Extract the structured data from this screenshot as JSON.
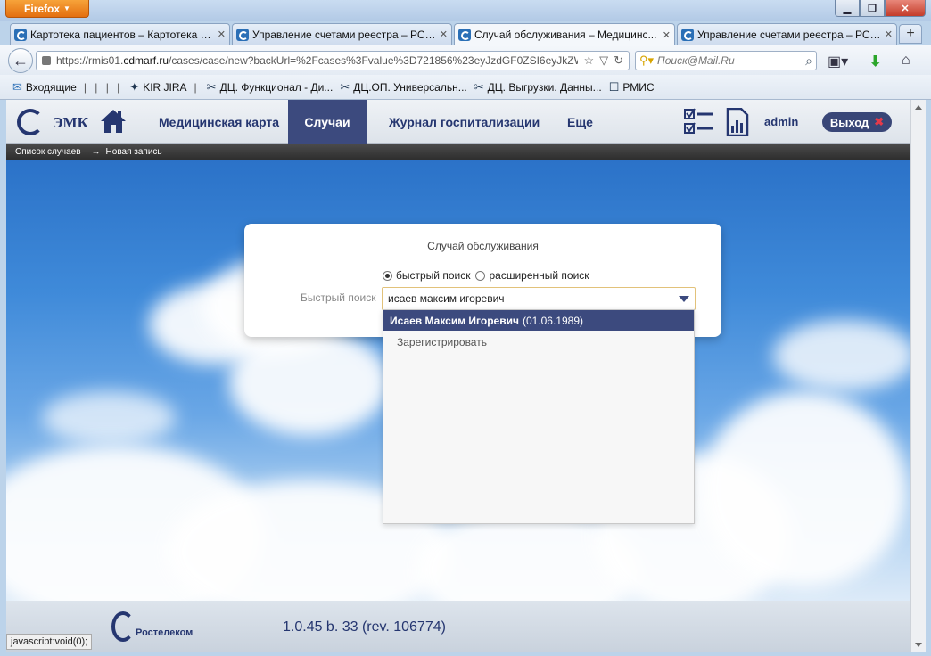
{
  "browser": {
    "menu_label": "Firefox",
    "tabs": [
      {
        "title": "Картотека пациентов – Картотека п..."
      },
      {
        "title": "Управление счетами реестра – РС Е..."
      },
      {
        "title": "Случай обслуживания – Медицинс..."
      },
      {
        "title": "Управление счетами реестра – РС Е..."
      }
    ],
    "new_tab": "+",
    "url_prefix": "https://rmis01.",
    "url_domain": "cdmarf.ru",
    "url_rest": "/cases/case/new?backUrl=%2Fcases%3Fvalue%3D721856%23eyJzdGF0ZSI6eyJkZWZh",
    "search_placeholder": "Поиск@Mail.Ru",
    "bookmarks": [
      "Входящие",
      "KIR JIRA",
      "ДЦ. Функционал - Ди...",
      "ДЦ.ОП. Универсальн...",
      "ДЦ. Выгрузки. Данны...",
      "РМИС"
    ],
    "status_text": "javascript:void(0);"
  },
  "app": {
    "brand": "ЭМК",
    "nav": [
      "Медицинская карта",
      "Случаи",
      "Журнал госпитализации",
      "Еще"
    ],
    "user": "admin",
    "logout": "Выход",
    "breadcrumb_root": "Список случаев",
    "breadcrumb_arrow": "→",
    "breadcrumb_current": "Новая запись"
  },
  "dialog": {
    "title": "Случай обслуживания",
    "radio_quick": "быстрый поиск",
    "radio_extended": "расширенный поиск",
    "quick_label": "Быстрый поиск",
    "query": "исаев максим игоревич"
  },
  "dropdown": {
    "selected_name": "Исаев Максим Игоревич",
    "selected_date": "(01.06.1989)",
    "register": "Зарегистрировать"
  },
  "footer": {
    "company": "Ростелеком",
    "version": "1.0.45 b. 33 (rev. 106774)"
  },
  "colors": {
    "brand": "#253670",
    "active_nav": "#3c4a7e",
    "browser_menu": "#e46f10"
  }
}
